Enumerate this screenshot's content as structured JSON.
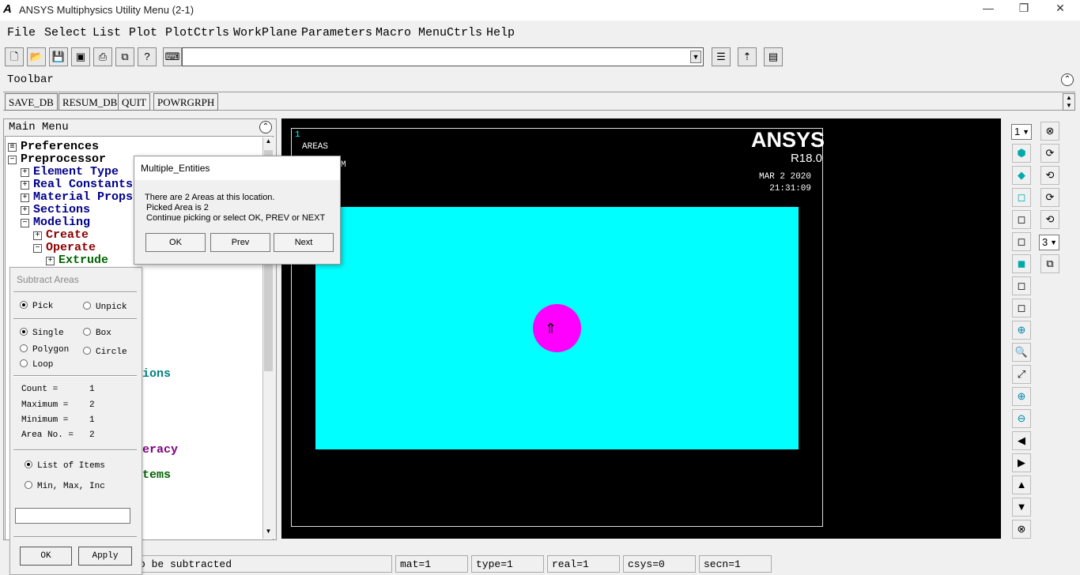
{
  "window": {
    "title": "ANSYS Multiphysics Utility Menu (2-1)",
    "minimize": "—",
    "restore": "❐",
    "close": "✕"
  },
  "menu": {
    "items": [
      "File",
      "Select",
      "List",
      "Plot",
      "PlotCtrls",
      "WorkPlane",
      "Parameters",
      "Macro",
      "MenuCtrls",
      "Help"
    ]
  },
  "toolbar": {
    "label": "Toolbar",
    "buttons": [
      "SAVE_DB",
      "RESUM_DB",
      "QUIT",
      "POWRGRPH"
    ],
    "command_input": ""
  },
  "main_menu": {
    "label": "Main Menu",
    "tree": [
      {
        "label": "Preferences"
      },
      {
        "label": "Preprocessor"
      },
      {
        "label": "Element Type"
      },
      {
        "label": "Real Constants"
      },
      {
        "label": "Material Props"
      },
      {
        "label": "Sections"
      },
      {
        "label": "Modeling"
      },
      {
        "label": "Create"
      },
      {
        "label": "Operate"
      },
      {
        "label": "Extrude"
      },
      {
        "label": "ions"
      },
      {
        "label": "eracy"
      },
      {
        "label": "tems"
      }
    ]
  },
  "graphics": {
    "window_number": "1",
    "plot_label": "AREAS",
    "plot_sublabel": "M",
    "brand": "ANSYS",
    "version": "R18.0",
    "date": "MAR  2 2020",
    "time": "21:31:09",
    "colors": {
      "background": "#000000",
      "area": "#00ffff",
      "selected_area": "#ff00ff"
    }
  },
  "right_panel": {
    "window_select": "1",
    "view_select": "3"
  },
  "subtract_dialog": {
    "title": "Subtract Areas",
    "pick": "Pick",
    "unpick": "Unpick",
    "single": "Single",
    "box": "Box",
    "polygon": "Polygon",
    "circle": "Circle",
    "loop": "Loop",
    "count_label": "Count    =",
    "count": "1",
    "maximum_label": "Maximum  =",
    "maximum": "2",
    "minimum_label": "Minimum  =",
    "minimum": "1",
    "area_no_label": "Area No. =",
    "area_no": "2",
    "list_items": "List of Items",
    "min_max_inc": "Min, Max, Inc",
    "entry": "",
    "ok": "OK",
    "apply": "Apply"
  },
  "multi_dialog": {
    "title": "Multiple_Entities",
    "line1": "There are   2 Areas at this location.",
    "line2": "Picked Area is 2",
    "line3": "Continue picking or select  OK, PREV or NEXT",
    "ok": "OK",
    "prev": "Prev",
    "next": "Next"
  },
  "status": {
    "prompt": "o be subtracted",
    "mat": "mat=1",
    "type": "type=1",
    "real": "real=1",
    "csys": "csys=0",
    "secn": "secn=1"
  }
}
